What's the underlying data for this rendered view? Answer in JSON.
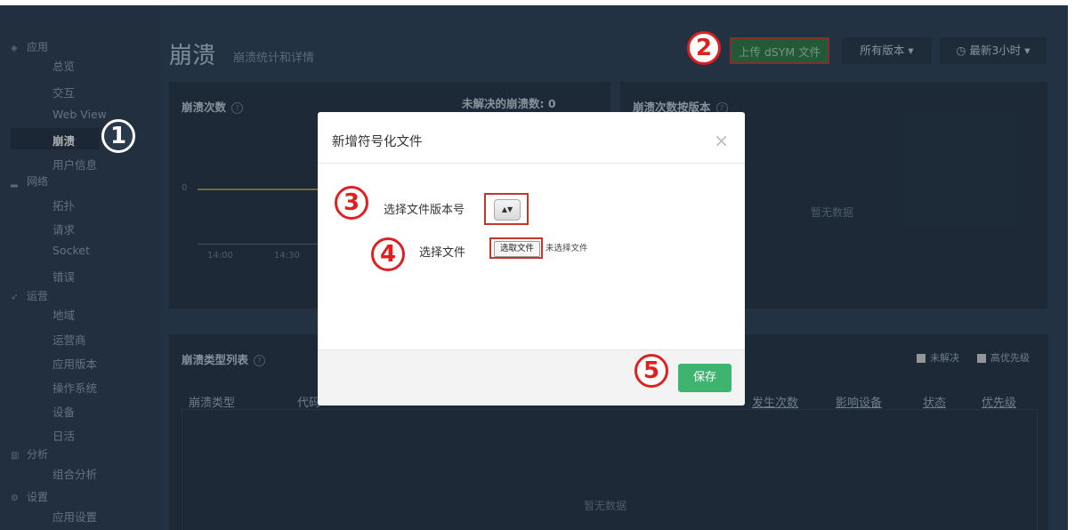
{
  "sidebar": {
    "groups": [
      {
        "label": "应用",
        "icon": "cube-icon",
        "items": [
          "总览",
          "交互",
          "Web View",
          "崩溃",
          "用户信息"
        ]
      },
      {
        "label": "网络",
        "icon": "signal-icon",
        "items": [
          "拓扑",
          "请求",
          "Socket",
          "错误"
        ]
      },
      {
        "label": "运营",
        "icon": "rocket-icon",
        "items": [
          "地域",
          "运营商",
          "应用版本",
          "操作系统",
          "设备",
          "日活"
        ]
      },
      {
        "label": "分析",
        "icon": "chart-icon",
        "items": [
          "组合分析"
        ]
      },
      {
        "label": "设置",
        "icon": "gears-icon",
        "items": [
          "应用设置"
        ]
      }
    ],
    "active_item": "崩溃"
  },
  "header": {
    "title": "崩溃",
    "subtitle": "崩溃统计和详情",
    "upload_label": "上传 dSYM 文件",
    "version_label": "所有版本 ▾",
    "time_label": "最新3小时 ▾"
  },
  "crash_panel": {
    "title": "崩溃次数",
    "unresolved_label": "未解决的崩溃数: 0",
    "y_tick": "0",
    "x_ticks": [
      "14:00",
      "14:30"
    ]
  },
  "version_panel": {
    "title": "崩溃次数按版本",
    "empty": "暂无数据"
  },
  "list_panel": {
    "title": "崩溃类型列表",
    "filter_unresolved": "未解决",
    "filter_priority": "高优先级",
    "columns": [
      "崩溃类型",
      "代码",
      "发生次数",
      "影响设备",
      "状态",
      "优先级"
    ],
    "empty": "暂无数据"
  },
  "modal": {
    "title": "新增符号化文件",
    "close": "×",
    "version_label": "选择文件版本号",
    "file_label": "选择文件",
    "file_button": "选取文件",
    "file_status": "未选择文件",
    "save_label": "保存"
  },
  "markers": [
    "1",
    "2",
    "3",
    "4",
    "5"
  ],
  "colors": {
    "accent_green": "#3fb370",
    "marker_red": "#e02020",
    "background": "#2c3e50"
  }
}
